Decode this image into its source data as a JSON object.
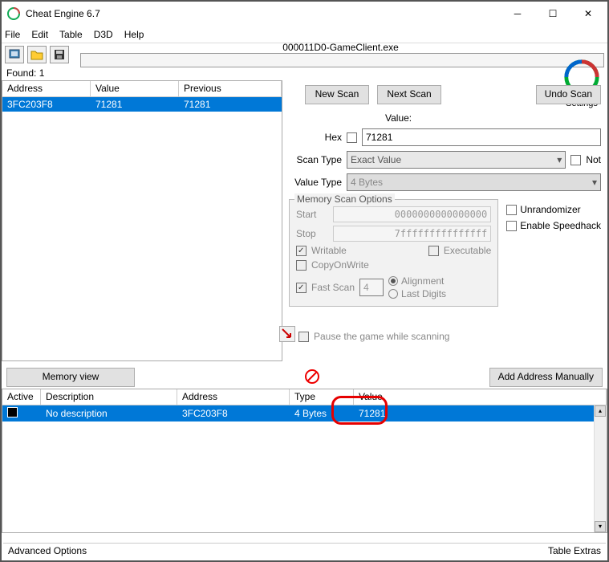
{
  "window": {
    "title": "Cheat Engine 6.7",
    "minimize_icon": "minimize",
    "maximize_icon": "maximize",
    "close_icon": "close"
  },
  "menu": {
    "file": "File",
    "edit": "Edit",
    "table": "Table",
    "d3d": "D3D",
    "help": "Help"
  },
  "process": {
    "attached": "000011D0-GameClient.exe"
  },
  "found": {
    "label": "Found: 1"
  },
  "settings_label": "Settings",
  "results": {
    "head_address": "Address",
    "head_value": "Value",
    "head_previous": "Previous",
    "rows": [
      {
        "address": "3FC203F8",
        "value": "71281",
        "prev": "71281"
      }
    ]
  },
  "scan": {
    "new_scan": "New Scan",
    "next_scan": "Next Scan",
    "undo_scan": "Undo Scan",
    "value_label": "Value:",
    "hex_label": "Hex",
    "value_input": "71281",
    "scan_type_label": "Scan Type",
    "scan_type_value": "Exact Value",
    "not_label": "Not",
    "value_type_label": "Value Type",
    "value_type_value": "4 Bytes",
    "mem_options_title": "Memory Scan Options",
    "start_label": "Start",
    "start_value": "0000000000000000",
    "stop_label": "Stop",
    "stop_value": "7fffffffffffffff",
    "writable": "Writable",
    "executable": "Executable",
    "copyonwrite": "CopyOnWrite",
    "fast_scan": "Fast Scan",
    "fast_scan_val": "4",
    "alignment": "Alignment",
    "last_digits": "Last Digits",
    "pause": "Pause the game while scanning",
    "unrandomizer": "Unrandomizer",
    "speedhack": "Enable Speedhack"
  },
  "buttons": {
    "memory_view": "Memory view",
    "add_manual": "Add Address Manually"
  },
  "table": {
    "head_active": "Active",
    "head_desc": "Description",
    "head_address": "Address",
    "head_type": "Type",
    "head_value": "Value",
    "rows": [
      {
        "desc": "No description",
        "address": "3FC203F8",
        "type": "4 Bytes",
        "value": "71281"
      }
    ]
  },
  "status": {
    "advanced": "Advanced Options",
    "extras": "Table Extras"
  }
}
